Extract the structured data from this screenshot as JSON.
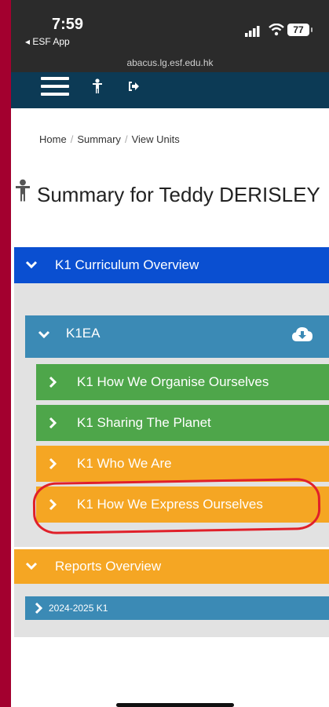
{
  "status_bar": {
    "time": "7:59",
    "back_app": "◂ ESF App",
    "battery": "77"
  },
  "browser": {
    "url": "abacus.lg.esf.edu.hk"
  },
  "navbar": {
    "icons": [
      "menu-icon",
      "person-icon",
      "logout-icon"
    ]
  },
  "breadcrumb": {
    "items": [
      "Home",
      "Summary",
      "View Units"
    ],
    "separator": "/"
  },
  "page": {
    "title": "Summary for Teddy DERISLEY"
  },
  "curriculum": {
    "header": "K1 Curriculum Overview",
    "class_group": {
      "header": "K1EA",
      "units": [
        {
          "label": "K1 How We Organise Ourselves",
          "color": "#4ea64a"
        },
        {
          "label": "K1 Sharing The Planet",
          "color": "#4ea64a"
        },
        {
          "label": "K1 Who We Are",
          "color": "#f5a623"
        },
        {
          "label": "K1 How We Express Ourselves",
          "color": "#f5a623"
        }
      ]
    }
  },
  "reports": {
    "header": "Reports Overview",
    "items": [
      {
        "label": "2024-2025 K1"
      }
    ]
  },
  "colors": {
    "frame": "#a3002f",
    "navbar": "#0c3a55",
    "curriculum_header": "#0a4fd1",
    "class_header": "#3b8ab5",
    "complete_unit": "#4ea64a",
    "pending_unit": "#f5a623",
    "annotation": "#e0202a"
  }
}
